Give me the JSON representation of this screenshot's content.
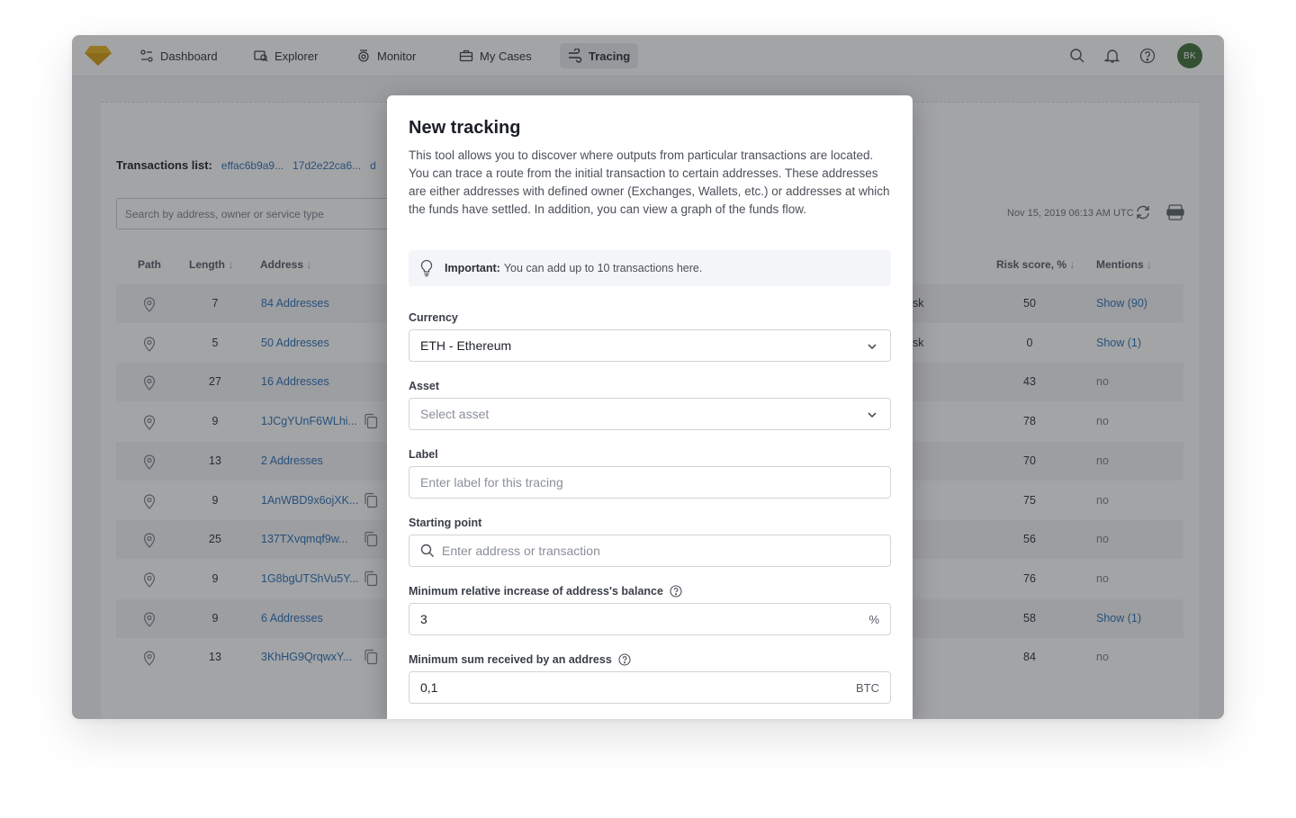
{
  "nav": {
    "items": [
      {
        "label": "Dashboard",
        "icon": "dashboard-icon"
      },
      {
        "label": "Explorer",
        "icon": "explorer-icon"
      },
      {
        "label": "Monitor",
        "icon": "monitor-icon"
      },
      {
        "label": "My Cases",
        "icon": "briefcase-icon"
      },
      {
        "label": "Tracing",
        "icon": "tracing-icon",
        "active": true
      }
    ],
    "avatar_initials": "BK",
    "colors": {
      "brand": "#e6b31e",
      "avatar": "#3e6f3a",
      "link": "#2a6fb5"
    }
  },
  "background": {
    "tx_list_label": "Transactions list:",
    "tx_links": [
      "effac6b9a9...",
      "17d2e22ca6...",
      "d"
    ],
    "search_placeholder": "Search by address, owner or service type",
    "timestamp": "Nov 15, 2019 06:13 AM UTC",
    "columns": {
      "path": "Path",
      "length": "Length",
      "address": "Address",
      "risk_score": "Risk score, %",
      "mentions": "Mentions"
    },
    "rows": [
      {
        "length": "7",
        "address": "84 Addresses",
        "risk_part": "sk",
        "score": "50",
        "mentions": "Show (90)"
      },
      {
        "length": "5",
        "address": "50 Addresses",
        "risk_part": "sk",
        "score": "0",
        "mentions": "Show (1)"
      },
      {
        "length": "27",
        "address": "16 Addresses",
        "risk_part": "",
        "score": "43",
        "mentions": "no"
      },
      {
        "length": "9",
        "address": "1JCgYUnF6WLhi...",
        "risk_part": "",
        "score": "78",
        "mentions": "no"
      },
      {
        "length": "13",
        "address": "2 Addresses",
        "risk_part": "",
        "score": "70",
        "mentions": "no"
      },
      {
        "length": "9",
        "address": "1AnWBD9x6ojXK...",
        "risk_part": "",
        "score": "75",
        "mentions": "no"
      },
      {
        "length": "25",
        "address": "137TXvqmqf9w...",
        "risk_part": "",
        "score": "56",
        "mentions": "no"
      },
      {
        "length": "9",
        "address": "1G8bgUTShVu5Y...",
        "risk_part": "",
        "score": "76",
        "mentions": "no"
      },
      {
        "length": "9",
        "address": "6 Addresses",
        "risk_part": "",
        "score": "58",
        "mentions": "Show (1)"
      },
      {
        "length": "13",
        "address": "3KhHG9QrqwxY...",
        "risk_part": "",
        "score": "84",
        "mentions": "no"
      }
    ]
  },
  "modal": {
    "title": "New tracking",
    "description": "This tool allows you to discover where outputs from particular transactions are located. You can trace a route from the initial transaction to certain addresses. These addresses are either addresses with defined owner (Exchanges, Wallets, etc.) or addresses at which the funds have settled. In addition, you can view a graph of the funds flow.",
    "notice_bold": "Important:",
    "notice_text": "You can add up to 10 transactions here.",
    "currency_label": "Currency",
    "currency_value": "ETH - Ethereum",
    "asset_label": "Asset",
    "asset_placeholder": "Select asset",
    "label_label": "Label",
    "label_placeholder": "Enter label for this tracing",
    "start_label": "Starting point",
    "start_placeholder": "Enter address or transaction",
    "min_increase_label": "Minimum relative increase of address's balance",
    "min_increase_value": "3",
    "min_increase_unit": "%",
    "min_sum_label": "Minimum sum received by an address",
    "min_sum_value": "0,1",
    "min_sum_unit": "BTC"
  }
}
